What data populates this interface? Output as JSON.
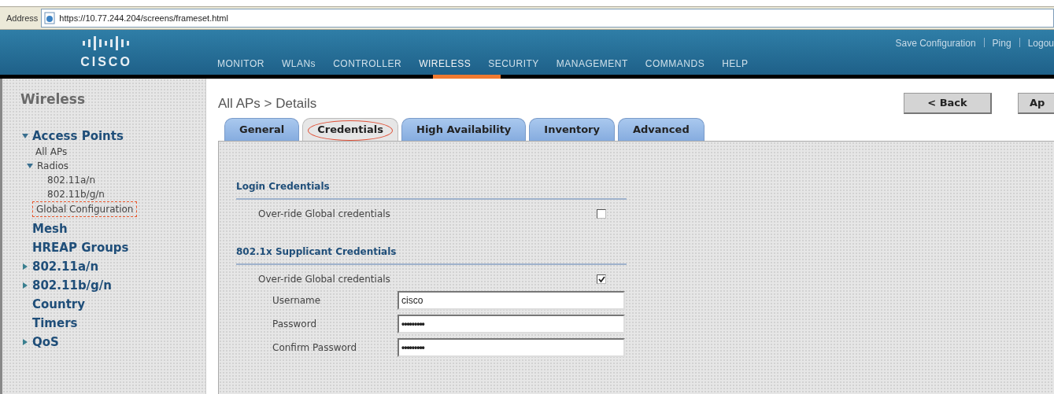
{
  "address_bar": {
    "label": "Address",
    "url": "https://10.77.244.204/screens/frameset.html"
  },
  "header": {
    "logo": "CISCO",
    "utility_links": [
      "Save Configuration",
      "Ping",
      "Logou"
    ],
    "nav": [
      {
        "label": "MONITOR",
        "selected": false
      },
      {
        "label": "WLANs",
        "selected": false
      },
      {
        "label": "CONTROLLER",
        "selected": false
      },
      {
        "label": "WIRELESS",
        "selected": true
      },
      {
        "label": "SECURITY",
        "selected": false
      },
      {
        "label": "MANAGEMENT",
        "selected": false
      },
      {
        "label": "COMMANDS",
        "selected": false
      },
      {
        "label": "HELP",
        "selected": false
      }
    ]
  },
  "sidebar": {
    "title": "Wireless",
    "items": [
      {
        "label": "Access Points",
        "kind": "folder",
        "expanded": true,
        "highlighted": false,
        "children": [
          {
            "label": "All APs",
            "kind": "link",
            "highlighted": false
          },
          {
            "label": "Radios",
            "kind": "folder",
            "expanded": true,
            "highlighted": false,
            "children": [
              {
                "label": "802.11a/n",
                "kind": "link",
                "highlighted": false
              },
              {
                "label": "802.11b/g/n",
                "kind": "link",
                "highlighted": false
              }
            ]
          },
          {
            "label": "Global Configuration",
            "kind": "link",
            "highlighted": true
          }
        ]
      },
      {
        "label": "Mesh",
        "kind": "link",
        "highlighted": false
      },
      {
        "label": "HREAP Groups",
        "kind": "link",
        "highlighted": false
      },
      {
        "label": "802.11a/n",
        "kind": "folder",
        "expanded": false,
        "highlighted": false
      },
      {
        "label": "802.11b/g/n",
        "kind": "folder",
        "expanded": false,
        "highlighted": false
      },
      {
        "label": "Country",
        "kind": "link",
        "highlighted": false
      },
      {
        "label": "Timers",
        "kind": "link",
        "highlighted": false
      },
      {
        "label": "QoS",
        "kind": "folder",
        "expanded": false,
        "highlighted": false
      }
    ]
  },
  "page": {
    "breadcrumb": "All APs > Details",
    "buttons": [
      "< Back",
      "Ap"
    ],
    "tabs": [
      {
        "label": "General",
        "selected": false,
        "highlighted": false
      },
      {
        "label": "Credentials",
        "selected": true,
        "highlighted": true
      },
      {
        "label": "High Availability",
        "selected": false,
        "highlighted": false
      },
      {
        "label": "Inventory",
        "selected": false,
        "highlighted": false
      },
      {
        "label": "Advanced",
        "selected": false,
        "highlighted": false
      }
    ],
    "sections": [
      {
        "title": "Login Credentials",
        "override": {
          "label": "Over-ride Global credentials",
          "checked": false
        }
      },
      {
        "title": "802.1x Supplicant Credentials",
        "override": {
          "label": "Over-ride Global credentials",
          "checked": true
        },
        "fields": [
          {
            "label": "Username",
            "value": "cisco",
            "kind": "text"
          },
          {
            "label": "Password",
            "value": "•••••••••",
            "kind": "password"
          },
          {
            "label": "Confirm Password",
            "value": "•••••••••",
            "kind": "password"
          }
        ]
      }
    ]
  }
}
